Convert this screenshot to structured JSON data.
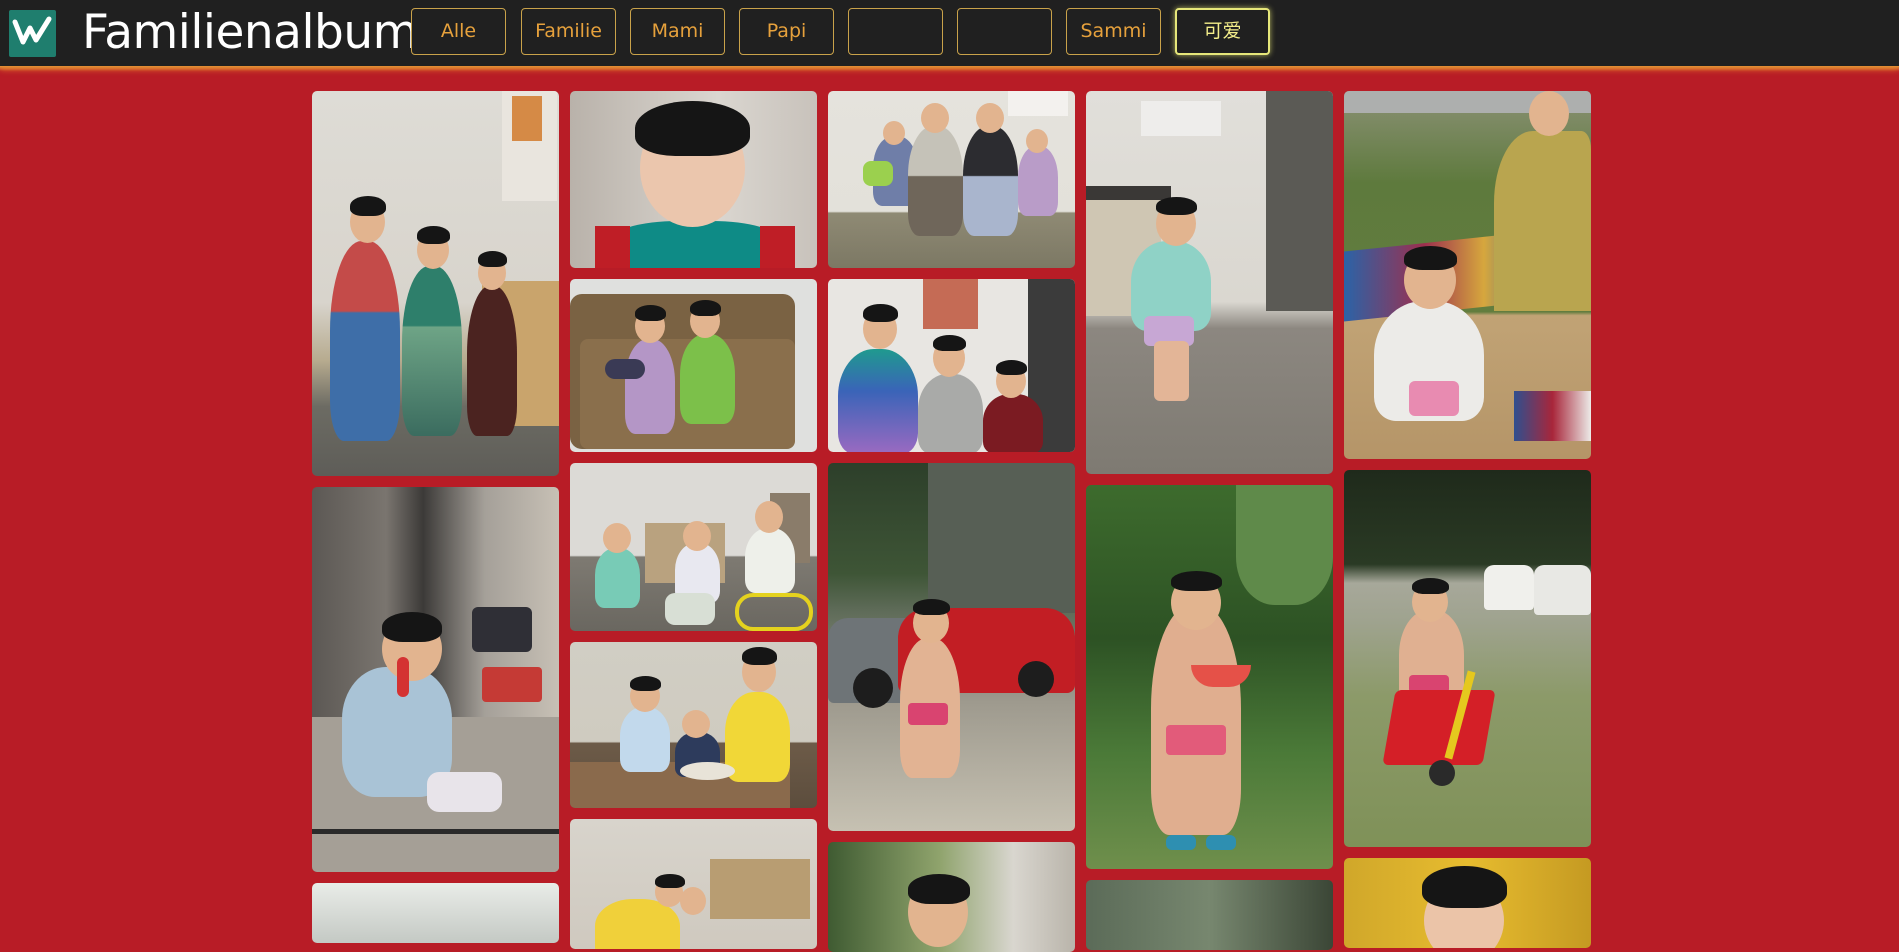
{
  "header": {
    "logo": "wy-logo",
    "title": "Familienalbum"
  },
  "filters": [
    {
      "label": "Alle",
      "active": false
    },
    {
      "label": "Familie",
      "active": false
    },
    {
      "label": "Mami",
      "active": false
    },
    {
      "label": "Papi",
      "active": false
    },
    {
      "label": "",
      "active": false
    },
    {
      "label": "",
      "active": false
    },
    {
      "label": "Sammi",
      "active": false
    },
    {
      "label": "可爱",
      "active": true
    }
  ],
  "colors": {
    "background": "#b81c26",
    "topbar": "#202020",
    "button_text": "#e6a13c",
    "active_button": "#f4ee8a",
    "logo": "#1f7e6e"
  },
  "gallery": {
    "photos": [
      {
        "name": "three-boys-standing-photo"
      },
      {
        "name": "toddler-close-up-photo"
      },
      {
        "name": "family-seated-photo"
      },
      {
        "name": "toddler-walking-indoor-photo"
      },
      {
        "name": "toddler-on-picnic-blanket-photo"
      },
      {
        "name": "boys-on-sofa-photo"
      },
      {
        "name": "boys-with-bowtie-photo"
      },
      {
        "name": "toddler-with-telephone-photo"
      },
      {
        "name": "kids-on-tricycles-photo"
      },
      {
        "name": "toddler-by-red-car-photo"
      },
      {
        "name": "toddler-with-watermelon-photo"
      },
      {
        "name": "toddler-with-wheelbarrow-photo"
      },
      {
        "name": "kids-at-table-photo"
      },
      {
        "name": "bottom-photo-1"
      },
      {
        "name": "bottom-photo-2"
      },
      {
        "name": "bottom-photo-3"
      },
      {
        "name": "bottom-photo-4"
      },
      {
        "name": "bottom-photo-5"
      }
    ]
  }
}
